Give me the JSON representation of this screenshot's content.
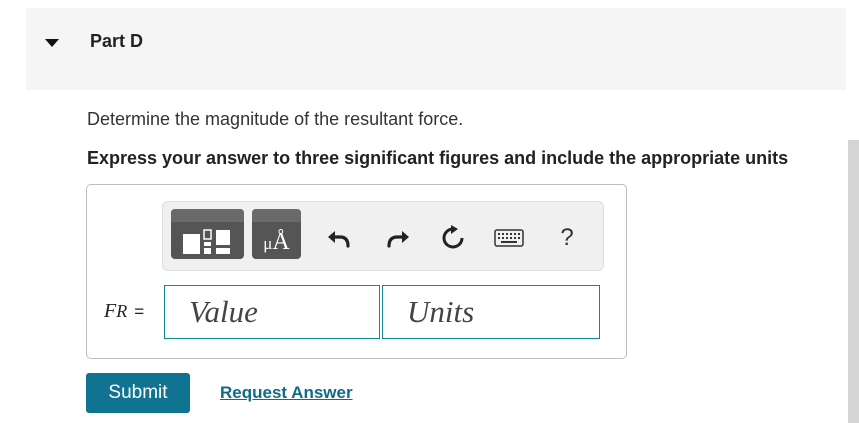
{
  "part": {
    "title": "Part D"
  },
  "question": {
    "prompt": "Determine the magnitude of the resultant force.",
    "instructions": "Express your answer to three significant figures and include the appropriate units"
  },
  "toolbar": {
    "templates_icon": "templates-icon",
    "units_icon": "units-icon",
    "units_glyph_mu": "μ",
    "units_glyph_a": "Å",
    "undo_icon": "undo-icon",
    "redo_icon": "redo-icon",
    "reset_icon": "reset-icon",
    "keyboard_icon": "keyboard-icon",
    "help_label": "?"
  },
  "answer": {
    "variable": "F",
    "subscript": "R",
    "equals": "=",
    "value_placeholder": "Value",
    "units_placeholder": "Units"
  },
  "actions": {
    "submit_label": "Submit",
    "request_label": "Request Answer"
  },
  "colors": {
    "accent": "#0f7391",
    "field_border": "#138a8f",
    "header_bg": "#f5f5f5"
  }
}
